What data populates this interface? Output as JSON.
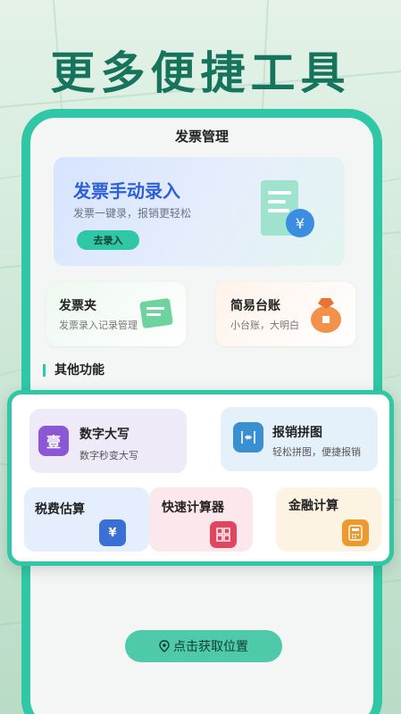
{
  "headline": "更多便捷工具",
  "screen": {
    "title": "发票管理",
    "banner": {
      "title": "发票手动录入",
      "subtitle": "发票一键录，报销更轻松",
      "button": "去录入",
      "currency_symbol": "¥"
    },
    "cards": [
      {
        "title": "发票夹",
        "subtitle": "发票录入记录管理"
      },
      {
        "title": "简易台账",
        "subtitle": "小台账，大明白"
      }
    ],
    "section_title": "其他功能",
    "location_button": "点击获取位置"
  },
  "tools": [
    {
      "title": "数字大写",
      "subtitle": "数字秒变大写",
      "icon_text": "壹",
      "icon": "chinese-numeral-icon"
    },
    {
      "title": "报销拼图",
      "subtitle": "轻松拼图，便捷报销",
      "icon": "merge-icon"
    },
    {
      "title": "税费估算",
      "icon": "tax-icon",
      "icon_text": "¥"
    },
    {
      "title": "快速计算器",
      "icon": "calculator-icon"
    },
    {
      "title": "金融计算",
      "icon": "finance-calculator-icon"
    }
  ],
  "colors": {
    "accent": "#2fc7a6",
    "headline": "#16745c",
    "banner_title": "#2d5fd8"
  }
}
